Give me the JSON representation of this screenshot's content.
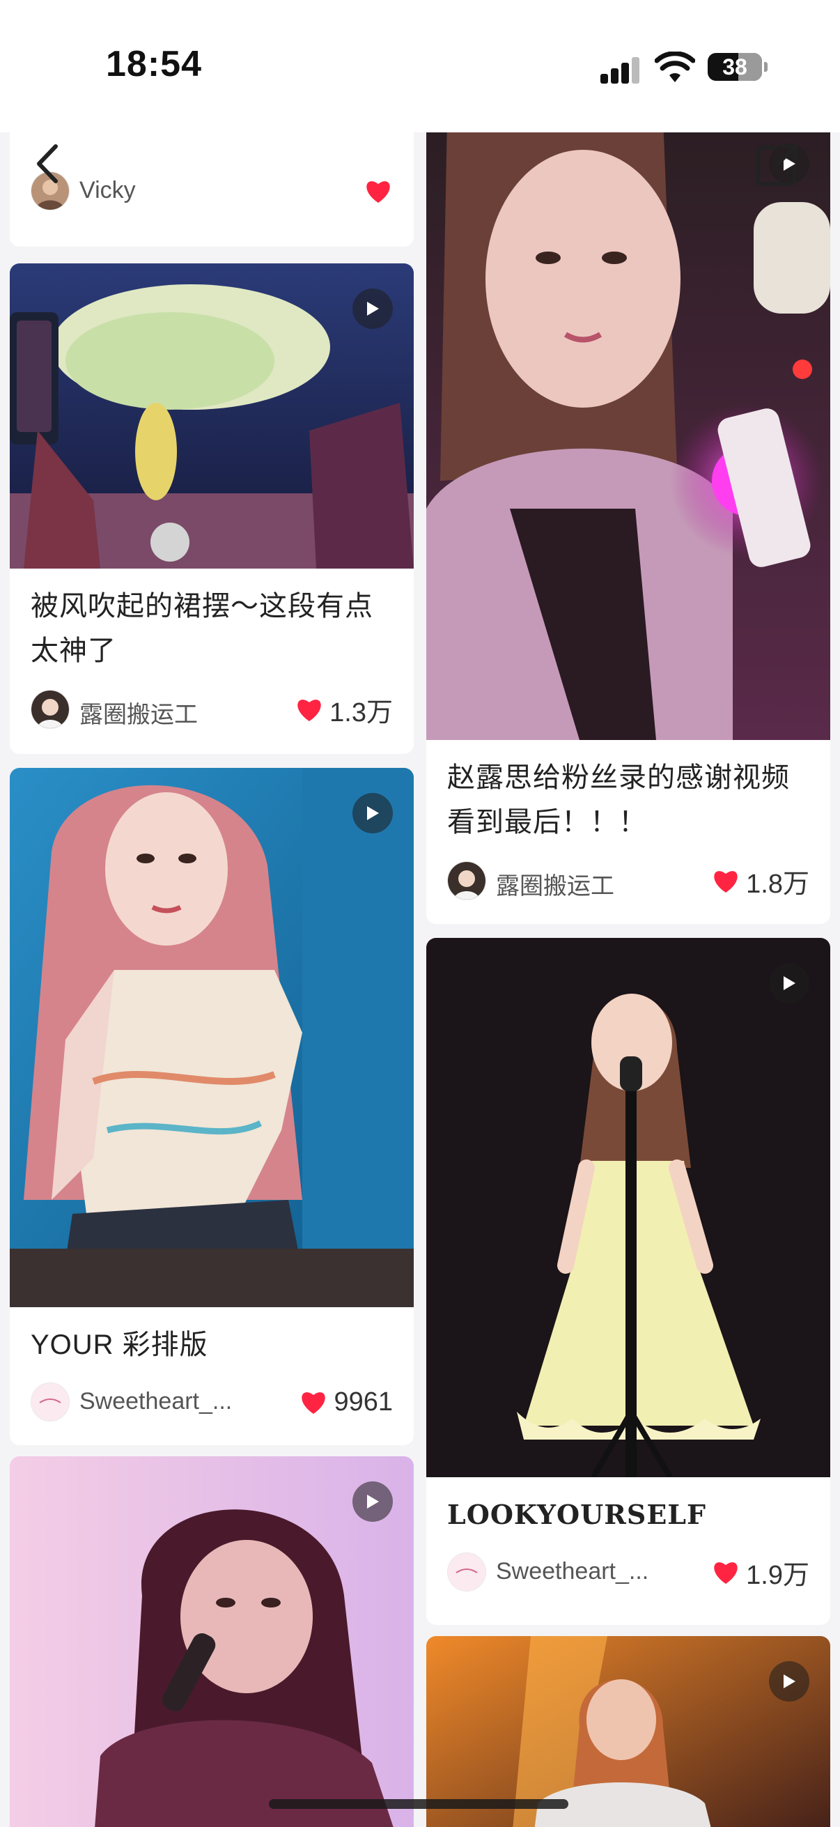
{
  "status": {
    "time": "18:54",
    "battery": "38"
  },
  "nav": {
    "back": "back",
    "share": "share"
  },
  "cards": [
    {
      "author": "Vicky"
    },
    {
      "title": "被风吹起的裙摆～这段有点太神了",
      "author": "露圈搬运工",
      "likes": "1.3万"
    },
    {
      "title": "赵露思给粉丝录的感谢视频看到最后！！！",
      "author": "露圈搬运工",
      "likes": "1.8万"
    },
    {
      "title": "YOUR 彩排版",
      "author": "Sweetheart_...",
      "likes": "9961"
    },
    {
      "title": "LOOKYOURSELF",
      "author": "Sweetheart_...",
      "likes": "1.9万"
    }
  ],
  "colors": {
    "accent": "#ff2442",
    "text": "#222222",
    "muted": "#555555"
  }
}
